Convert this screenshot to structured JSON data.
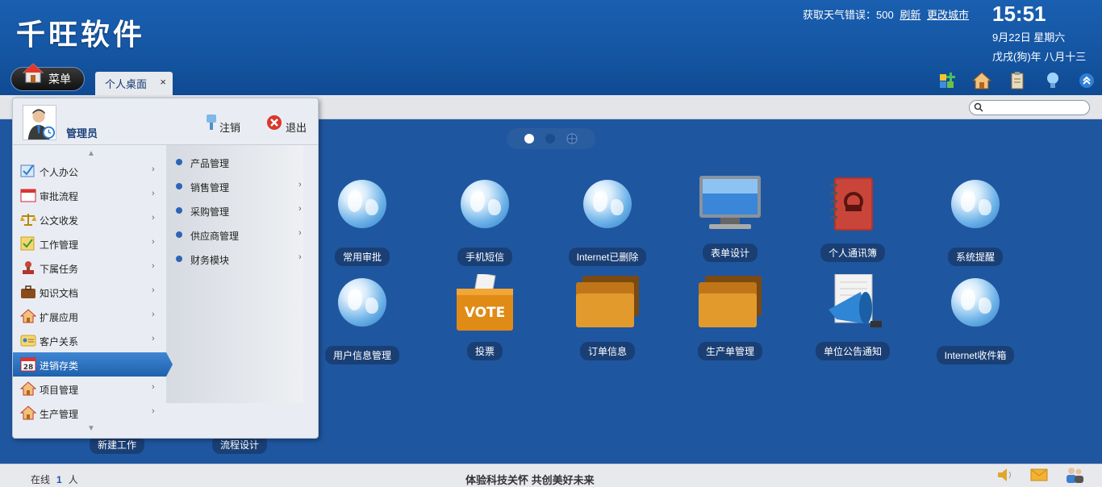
{
  "header": {
    "logo": "千旺软件",
    "weather_text": "获取天气错误：500",
    "refresh_link": "刷新",
    "change_city_link": "更改城市",
    "clock": "15:51",
    "date_line1": "9月22日 星期六",
    "date_line2": "戊戌(狗)年 八月十三"
  },
  "menu_button": {
    "label": "菜单"
  },
  "tabs": [
    {
      "label": "个人桌面",
      "close": "×"
    }
  ],
  "toolbar_icons": [
    "add-widget-icon",
    "home-settings-icon",
    "clipboard-icon",
    "bulb-icon",
    "collapse-up-icon"
  ],
  "search": {
    "placeholder": ""
  },
  "start_menu": {
    "user": "管理员",
    "logout_label": "注销",
    "quit_label": "退出",
    "items": [
      {
        "label": "个人办公",
        "icon": "checkbox-icon",
        "has_sub": true
      },
      {
        "label": "审批流程",
        "icon": "calendar-icon",
        "has_sub": true
      },
      {
        "label": "公文收发",
        "icon": "scale-icon",
        "has_sub": true
      },
      {
        "label": "工作管理",
        "icon": "note-icon",
        "has_sub": true
      },
      {
        "label": "下属任务",
        "icon": "stamp-icon",
        "has_sub": true
      },
      {
        "label": "知识文档",
        "icon": "briefcase-icon",
        "has_sub": true
      },
      {
        "label": "扩展应用",
        "icon": "house-icon",
        "has_sub": true
      },
      {
        "label": "客户关系",
        "icon": "card-icon",
        "has_sub": true
      },
      {
        "label": "进销存类",
        "icon": "calendar-28-icon",
        "has_sub": false,
        "active": true
      },
      {
        "label": "项目管理",
        "icon": "house-icon",
        "has_sub": true
      },
      {
        "label": "生产管理",
        "icon": "house-icon",
        "has_sub": true
      }
    ],
    "sub_items": [
      {
        "label": "产品管理",
        "has_sub": false
      },
      {
        "label": "销售管理",
        "has_sub": true
      },
      {
        "label": "采购管理",
        "has_sub": true
      },
      {
        "label": "供应商管理",
        "has_sub": true
      },
      {
        "label": "财务模块",
        "has_sub": true
      }
    ]
  },
  "desktop": {
    "apps_row1": [
      {
        "label": "常用审批",
        "icon": "globe-icon"
      },
      {
        "label": "手机短信",
        "icon": "globe-icon"
      },
      {
        "label": "Internet已删除",
        "icon": "globe-icon"
      },
      {
        "label": "表单设计",
        "icon": "monitor-icon"
      },
      {
        "label": "个人通讯簿",
        "icon": "address-book-icon"
      },
      {
        "label": "系统提醒",
        "icon": "globe-icon"
      }
    ],
    "apps_row2": [
      {
        "label": "用户信息管理",
        "icon": "globe-icon"
      },
      {
        "label": "投票",
        "icon": "vote-box-icon",
        "box_text": "VOTE"
      },
      {
        "label": "订单信息",
        "icon": "folder-icon"
      },
      {
        "label": "生产单管理",
        "icon": "folder-icon"
      },
      {
        "label": "单位公告通知",
        "icon": "megaphone-icon"
      },
      {
        "label": "Internet收件箱",
        "icon": "globe-icon"
      }
    ],
    "apps_row3": [
      {
        "label": "新建工作"
      },
      {
        "label": "流程设计"
      }
    ]
  },
  "status_bar": {
    "online_prefix": "在线",
    "online_count": "1",
    "online_suffix": "人",
    "slogan": "体验科技关怀 共创美好未来"
  },
  "colors": {
    "header": "#1556a3",
    "desktop": "#1f56a0",
    "accent": "#2d65b6"
  }
}
